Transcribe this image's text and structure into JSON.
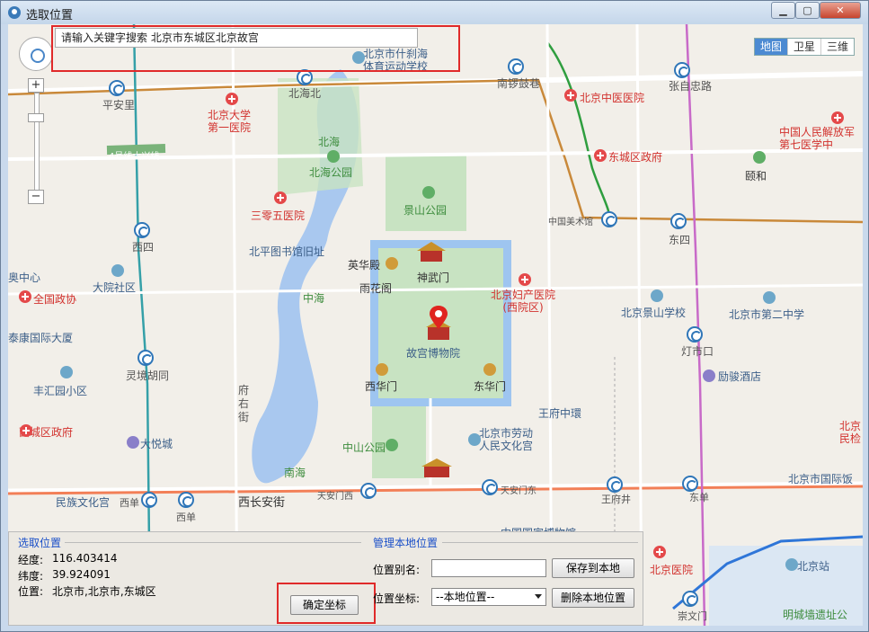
{
  "window": {
    "title": "选取位置",
    "minimize": "▁",
    "maximize": "▢",
    "close": "✕"
  },
  "search": {
    "text": "请输入关键字搜索 北京市东城区北京故宫"
  },
  "map_type": {
    "options": [
      "地图",
      "卫星",
      "三维"
    ],
    "selected": "地图"
  },
  "zoom": {
    "in": "+",
    "out": "−"
  },
  "map_labels": {
    "shichahai_school": "北京市什刹海\n体育运动学校",
    "beihaibei": "北海北",
    "nanluoguxiang": "南锣鼓巷",
    "zhangzilu": "张自忠路",
    "pinganli": "平安里",
    "pku_hospital": "北京大学\n第一医院",
    "tcm_hospital": "北京中医医院",
    "pla_hospital": "中国人民解放军\n第七医学中",
    "beihai": "北海",
    "beihai_park": "北海公园",
    "dongcheng_gov": "东城区政府",
    "heping": "颐和",
    "line4": "4号线大兴线",
    "jingshan": "景山公园",
    "sanlingwu": "三零五医院",
    "meishuguan": "中国美术馆",
    "dongsi": "东四",
    "xisi": "西四",
    "library": "北平图书馆旧址",
    "yinghua": "英华殿",
    "shenwu": "神武门",
    "aozhongxin": "奥中心",
    "dayuan": "大院社区",
    "yuhuage": "雨花阁",
    "fuchan": "北京妇产医院\n(西院区)",
    "quanguozx": "全国政协",
    "zhonghai": "中海",
    "jingshan_school": "北京景山学校",
    "no2_school": "北京市第二中学",
    "taikang": "泰康国际大厦",
    "palace_museum": "故宫博物院",
    "dengshikou": "灯市口",
    "lingjing": "灵境胡同",
    "fengyuan": "丰汇园小区",
    "xihuamen": "西华门",
    "donghuamen": "东华门",
    "lijun": "励骏酒店",
    "fuyoujie": "府\n右\n街",
    "wangfujing_zh": "王府中環",
    "xicheng_gov": "西城区政府",
    "beijing_labor": "北京市劳动\n人民文化宫",
    "beijing_min": "北京\n民检",
    "dayue": "大悦城",
    "zhongshan": "中山公园",
    "nanhai": "南海",
    "international": "北京市国际饭",
    "minzu": "民族文化宫",
    "xidan": "西单",
    "xichang": "西长安街",
    "tiananmenxi": "天安门西",
    "tiananmendong": "天安门东",
    "wangfujing": "王府井",
    "dongdan": "东单",
    "museum": "中国国家博物馆",
    "beijing_station": "北京站",
    "hospital_bottom": "北京医院",
    "chongwenmen": "崇文门",
    "mingcheng": "明城墙遗址公",
    "dongsi_right": "东四"
  },
  "selected_location": {
    "group_title": "选取位置",
    "lon_label": "经度:",
    "lon_value": "116.403414",
    "lat_label": "纬度:",
    "lat_value": "39.924091",
    "pos_label": "位置:",
    "pos_value": "北京市,北京市,东城区",
    "confirm_button": "确定坐标"
  },
  "local_manage": {
    "group_title": "管理本地位置",
    "alias_label": "位置别名:",
    "alias_value": "",
    "save_button": "保存到本地",
    "coord_label": "位置坐标:",
    "coord_select": "--本地位置--",
    "delete_button": "删除本地位置"
  }
}
